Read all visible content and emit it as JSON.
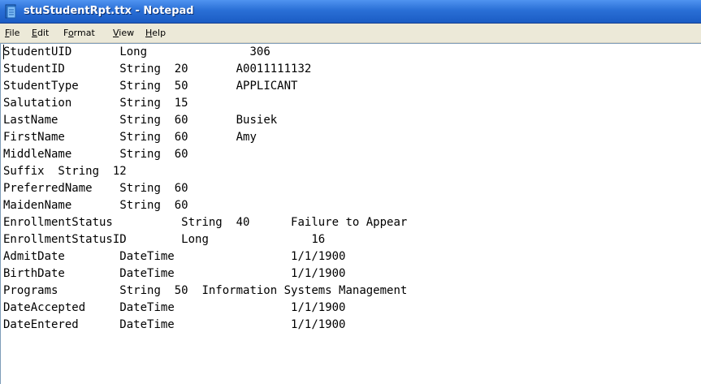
{
  "window": {
    "title": "stuStudentRpt.ttx - Notepad",
    "icon": "notepad-icon"
  },
  "menu": {
    "file": {
      "first": "F",
      "rest": "ile"
    },
    "edit": {
      "first": "E",
      "rest": "dit"
    },
    "format": {
      "before": "F",
      "accel": "o",
      "after": "rmat"
    },
    "view": {
      "first": "V",
      "rest": "iew"
    },
    "help": {
      "first": "H",
      "rest": "elp"
    }
  },
  "editor": {
    "lines": [
      [
        "StudentUID",
        "Long",
        "",
        "306"
      ],
      [
        "StudentID",
        "String",
        "20",
        "A0011111132"
      ],
      [
        "StudentType",
        "String",
        "50",
        "APPLICANT"
      ],
      [
        "Salutation",
        "String",
        "15",
        ""
      ],
      [
        "LastName",
        "String",
        "60",
        "Busiek"
      ],
      [
        "FirstName",
        "String",
        "60",
        "Amy"
      ],
      [
        "MiddleName",
        "String",
        "60",
        ""
      ],
      [
        "Suffix  String  12",
        "",
        "",
        ""
      ],
      [
        "PreferredName",
        "String",
        "60",
        ""
      ],
      [
        "MaidenName",
        "String",
        "60",
        ""
      ],
      [
        "EnrollmentStatus",
        "String",
        "40",
        "Failure to Appear"
      ],
      [
        "EnrollmentStatusID",
        "Long",
        "",
        "16"
      ],
      [
        "AdmitDate",
        "DateTime",
        "",
        "1/1/1900"
      ],
      [
        "BirthDate",
        "DateTime",
        "",
        "1/1/1900"
      ],
      [
        "Programs",
        "String",
        "50",
        "Information Systems Management"
      ],
      [
        "DateAccepted",
        "DateTime",
        "",
        "1/1/1900"
      ],
      [
        "DateEntered",
        "DateTime",
        "",
        "1/1/1900"
      ]
    ]
  },
  "colors": {
    "titlebar": "#2a6fd6",
    "menubar": "#ece9d8",
    "editor_background": "#ffffff",
    "text": "#000000"
  }
}
